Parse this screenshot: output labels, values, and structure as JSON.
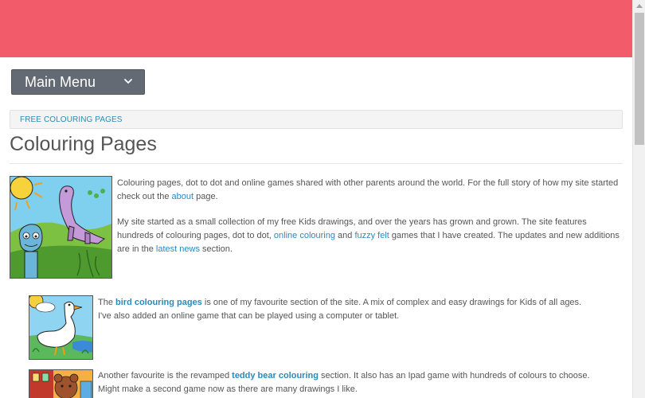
{
  "header": {
    "banner_color": "#f25c6a"
  },
  "menu": {
    "label": "Main Menu",
    "icon": "chevron-down-icon"
  },
  "breadcrumb": {
    "item": "FREE COLOURING PAGES"
  },
  "page": {
    "title": "Colouring Pages"
  },
  "intro": {
    "p1_text1": "Colouring pages, dot to dot and online games shared with other parents around the world. For the full story of how my site started check out the ",
    "p1_link_about": "about",
    "p1_text2": " page.",
    "p2_text1": "My site started as a small collection of my free Kids drawings, and over the years has grown and grown. The site features hundreds of colouring pages, dot to dot, ",
    "p2_link_online": "online colouring",
    "p2_text2": " and ",
    "p2_link_fuzzy": "fuzzy felt",
    "p2_text3": " games that I have created. The updates and new additions are in the ",
    "p2_link_news": "latest news",
    "p2_text4": " section."
  },
  "features": [
    {
      "text1": "The ",
      "link": "bird colouring pages",
      "text2": " is one of my favourite section of the site. A mix of complex and easy drawings for Kids of all ages. I've also added an online game that can be played using a computer or tablet."
    },
    {
      "text1": "Another favourite is the revamped ",
      "link": "teddy bear colouring",
      "text2": " section. It also has an Ipad game with hundreds of colours to choose. Might make a second game now as there are many drawings I like."
    }
  ],
  "colors": {
    "link": "#2b8ab8",
    "menu_bg": "#646a73",
    "text": "#555555"
  }
}
